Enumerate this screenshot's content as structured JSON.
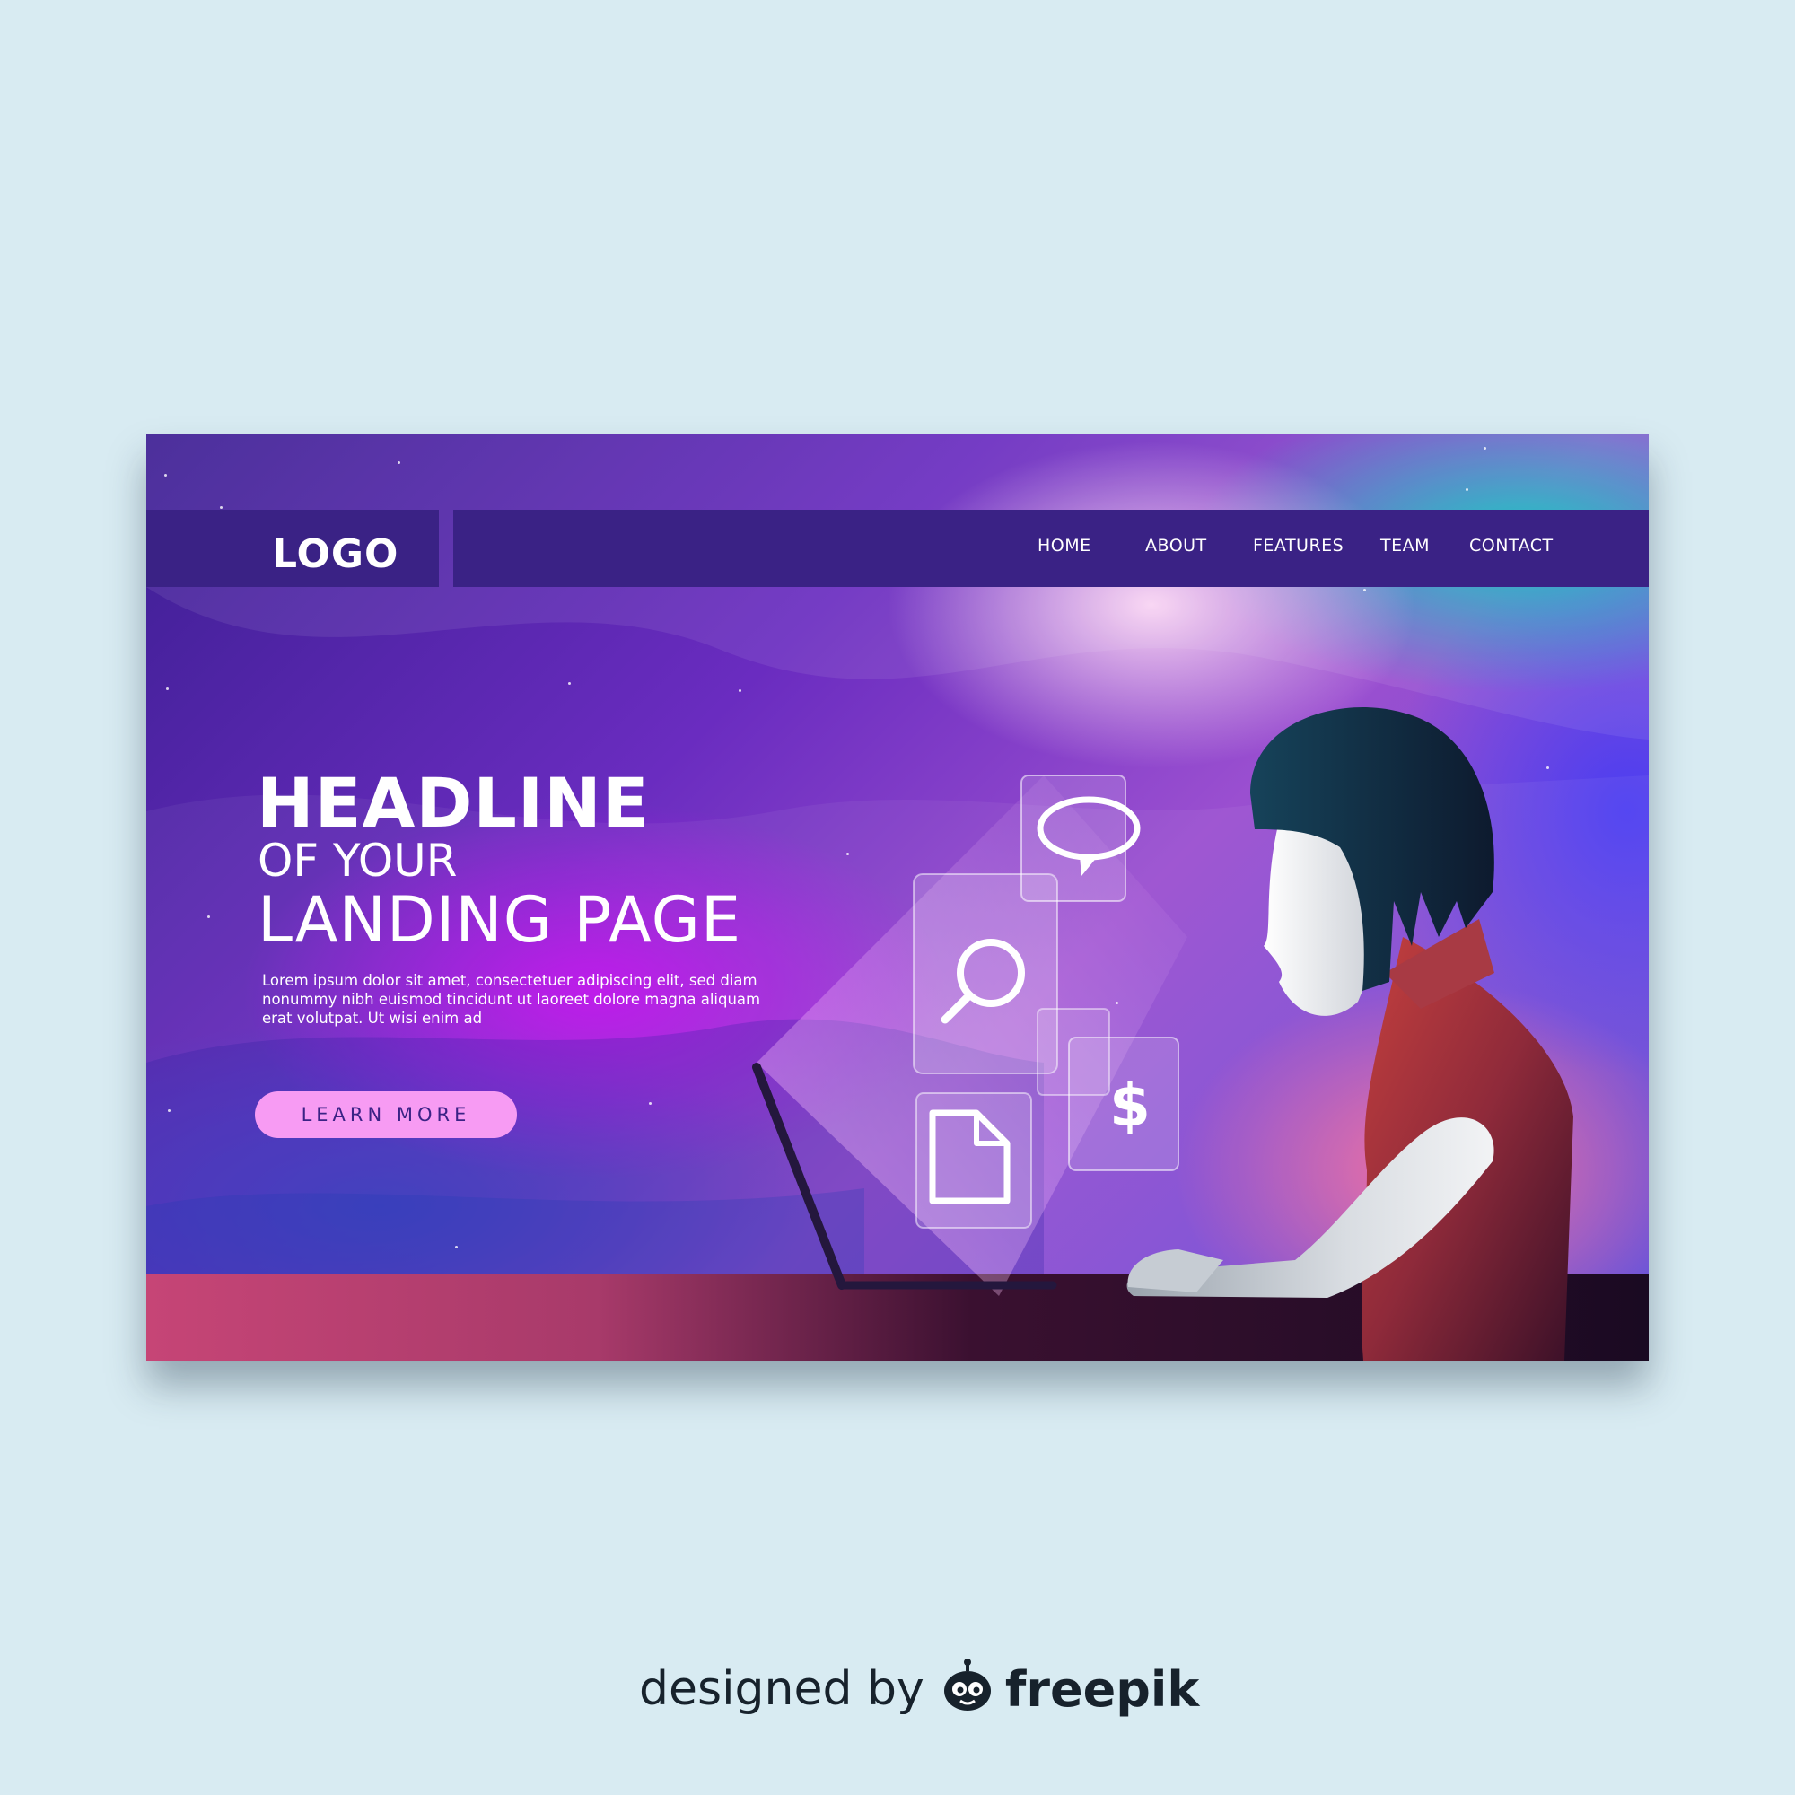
{
  "header": {
    "logo": "LOGO",
    "nav": [
      {
        "label": "HOME"
      },
      {
        "label": "ABOUT"
      },
      {
        "label": "FEATURES"
      },
      {
        "label": "TEAM"
      },
      {
        "label": "CONTACT"
      }
    ]
  },
  "hero": {
    "headline_line1": "HEADLINE",
    "headline_line2": "OF YOUR",
    "headline_line3": "LANDING PAGE",
    "body": "Lorem ipsum dolor sit amet, consectetuer adipiscing elit, sed diam nonummy nibh euismod tincidunt ut laoreet dolore magna aliquam erat volutpat. Ut wisi enim ad",
    "cta_label": "LEARN MORE",
    "floating_icons": [
      "speech-bubble-icon",
      "magnifier-icon",
      "dollar-icon",
      "document-icon"
    ],
    "dollar_symbol": "$"
  },
  "credit": {
    "designed_by": "designed by",
    "brand": "freepik"
  },
  "colors": {
    "page_background": "#d8ebf2",
    "nav_background": "#3a2285",
    "cta_background": "#f79bf3",
    "cta_text": "#3a2285",
    "credit_text": "#17222c"
  }
}
